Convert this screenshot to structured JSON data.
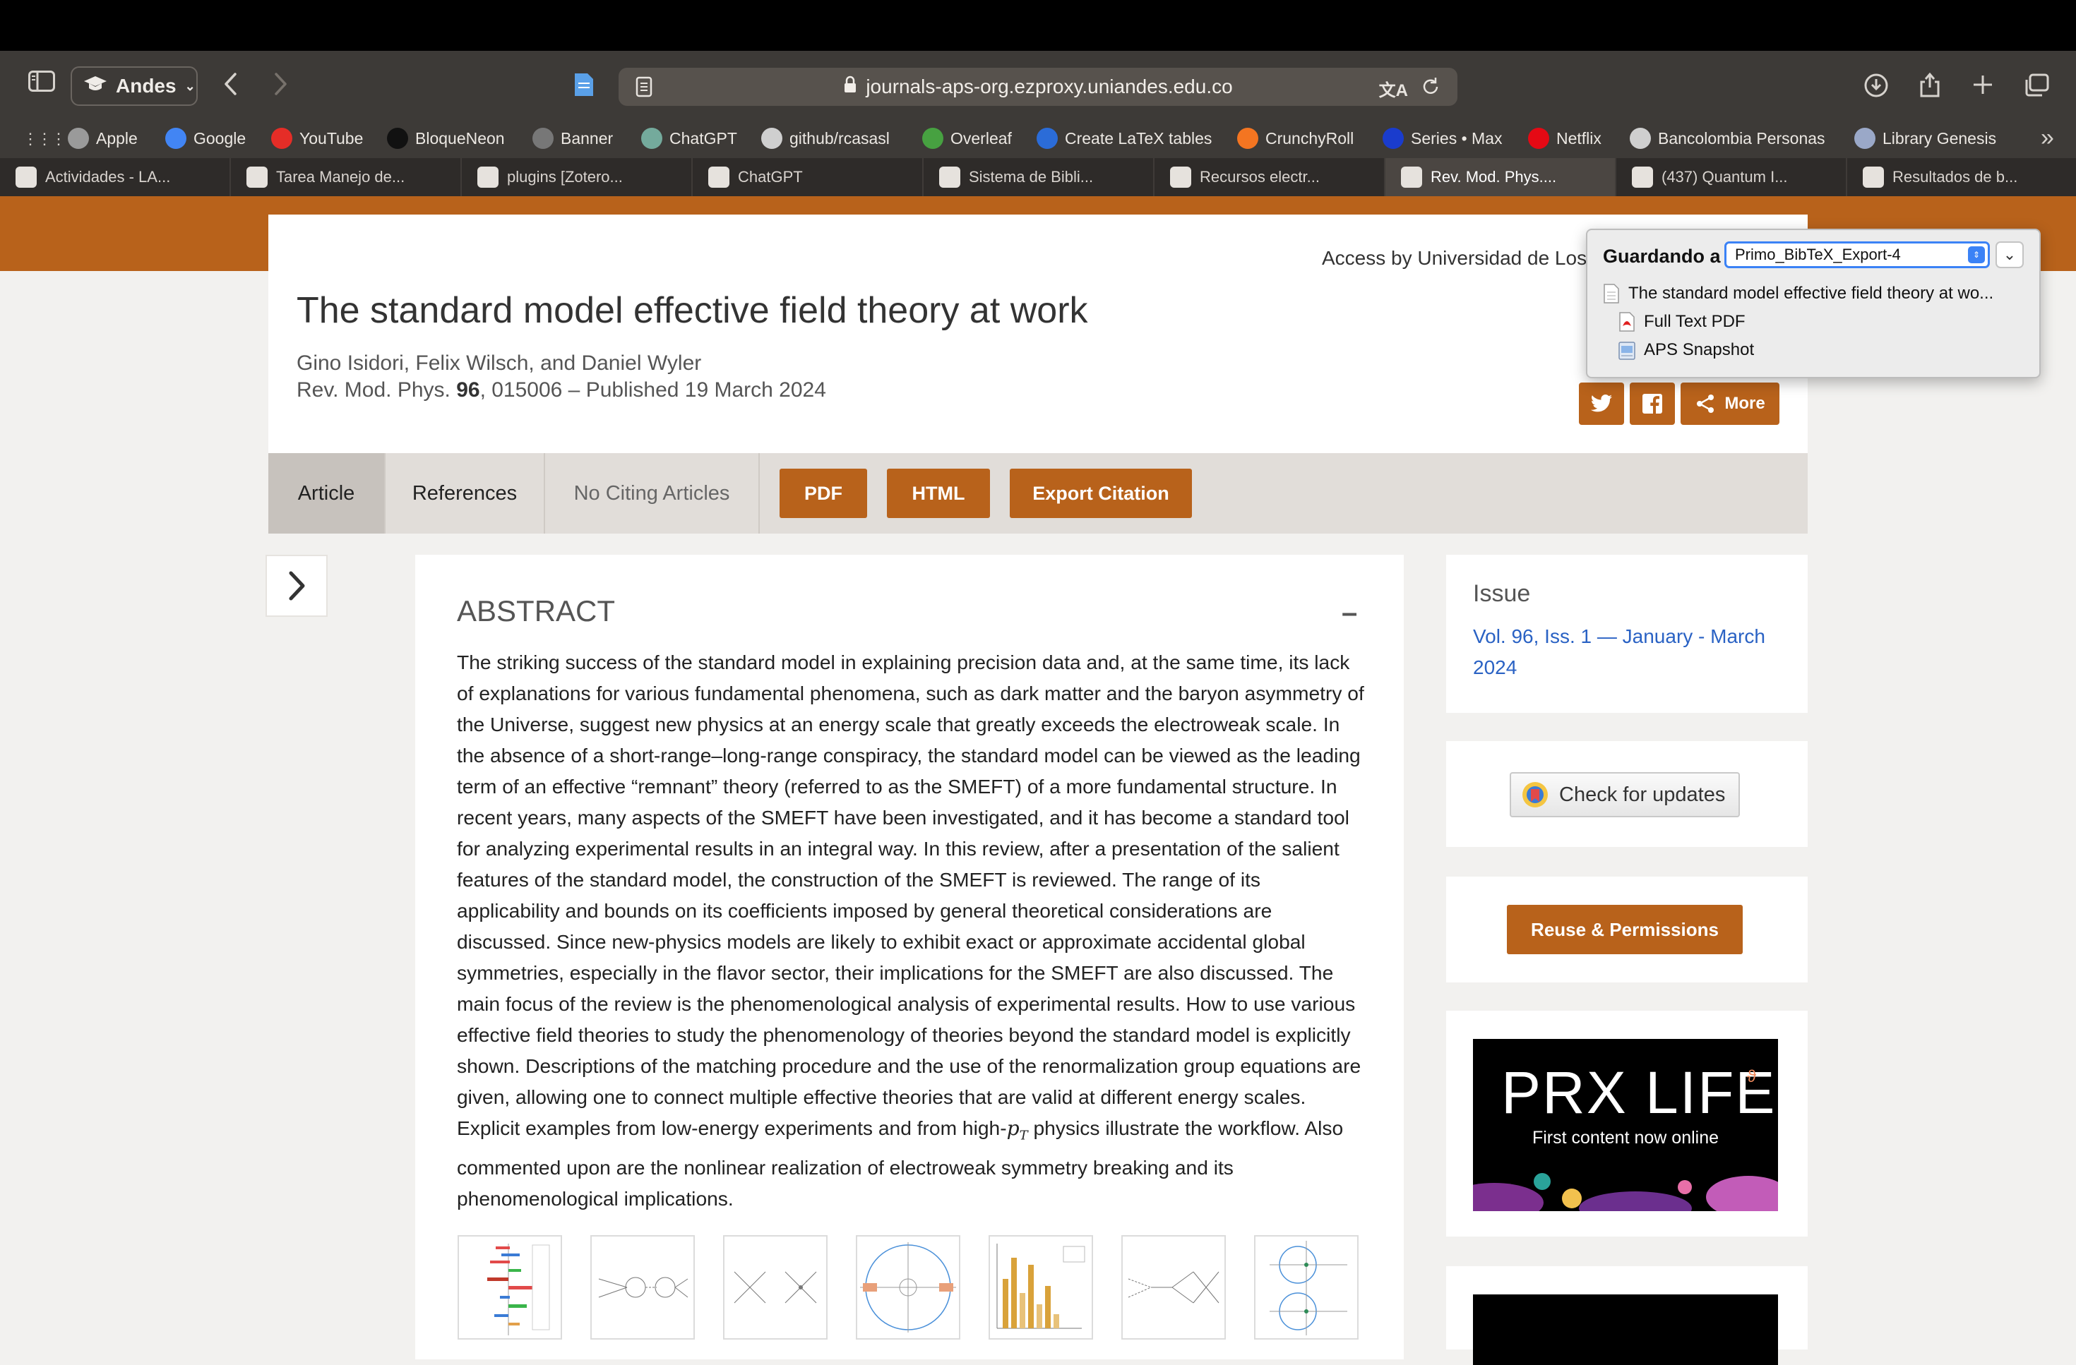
{
  "browser": {
    "profile_name": "Andes",
    "url": "journals-aps-org.ezproxy.uniandes.edu.co",
    "bookmarks": [
      {
        "label": "Apple",
        "icon": "apple-icon",
        "color": "#9a9a9a"
      },
      {
        "label": "Google",
        "icon": "google-icon",
        "color": "#4285f4"
      },
      {
        "label": "YouTube",
        "icon": "youtube-icon",
        "color": "#e52d27"
      },
      {
        "label": "BloqueNeon",
        "icon": "d2l-icon",
        "color": "#111111"
      },
      {
        "label": "Banner",
        "icon": "banner-icon",
        "color": "#777777"
      },
      {
        "label": "ChatGPT",
        "icon": "chatgpt-icon",
        "color": "#74aa9c"
      },
      {
        "label": "github/rcasasl",
        "icon": "github-icon",
        "color": "#cfcfcf"
      },
      {
        "label": "Overleaf",
        "icon": "overleaf-icon",
        "color": "#47a141"
      },
      {
        "label": "Create LaTeX tables",
        "icon": "table-icon",
        "color": "#2b6cd8"
      },
      {
        "label": "CrunchyRoll",
        "icon": "crunchyroll-icon",
        "color": "#f47521"
      },
      {
        "label": "Series • Max",
        "icon": "max-icon",
        "color": "#1a3ccd"
      },
      {
        "label": "Netflix",
        "icon": "netflix-icon",
        "color": "#e50914"
      },
      {
        "label": "Bancolombia Personas",
        "icon": "bancolombia-icon",
        "color": "#cfcfcf"
      },
      {
        "label": "Library Genesis",
        "icon": "library-icon",
        "color": "#9aa8c8"
      }
    ],
    "tabs": [
      {
        "label": "Actividades - LA...",
        "icon": "d2l-icon",
        "active": false
      },
      {
        "label": "Tarea Manejo de...",
        "icon": "overleaf-icon",
        "active": false
      },
      {
        "label": "plugins [Zotero...",
        "icon": "zotero-icon",
        "active": false
      },
      {
        "label": "ChatGPT",
        "icon": "chatgpt-icon",
        "active": false
      },
      {
        "label": "Sistema de Bibli...",
        "icon": "library-icon",
        "active": false
      },
      {
        "label": "Recursos electr...",
        "icon": "library-icon",
        "active": false
      },
      {
        "label": "Rev. Mod. Phys....",
        "icon": "aps-icon",
        "active": true
      },
      {
        "label": "(437) Quantum I...",
        "icon": "youtube-icon",
        "active": false
      },
      {
        "label": "Resultados de b...",
        "icon": "proquest-icon",
        "active": false
      }
    ]
  },
  "page": {
    "access_text": "Access by Universidad de Los",
    "title": "The standard model effective field theory at work",
    "authors": "Gino Isidori, Felix Wilsch, and Daniel Wyler",
    "journal_prefix": "Rev. Mod. Phys. ",
    "volume": "96",
    "citation_rest": ", 015006 – Published 19 March 2024",
    "share_more_label": "More",
    "tabs": [
      "Article",
      "References",
      "No Citing Articles"
    ],
    "buttons": [
      "PDF",
      "HTML",
      "Export Citation"
    ],
    "abstract_heading": "ABSTRACT",
    "abstract_collapse": "–",
    "abstract_part1": "The striking success of the standard model in explaining precision data and, at the same time, its lack of explanations for various fundamental phenomena, such as dark matter and the baryon asymmetry of the Universe, suggest new physics at an energy scale that greatly exceeds the electroweak scale. In the absence of a short-range–long-range conspiracy, the standard model can be viewed as the leading term of an effective “remnant” theory (referred to as the SMEFT) of a more fundamental structure. In recent years, many aspects of the SMEFT have been investigated, and it has become a standard tool for analyzing experimental results in an integral way. In this review, after a presentation of the salient features of the standard model, the construction of the SMEFT is reviewed. The range of its applicability and bounds on its coefficients imposed by general theoretical considerations are discussed. Since new-physics models are likely to exhibit exact or approximate accidental global symmetries, especially in the flavor sector, their implications for the SMEFT are also discussed. The main focus of the review is the phenomenological analysis of experimental results. How to use various effective field theories to study the phenomenology of theories beyond the standard model is explicitly shown. Descriptions of the matching procedure and the use of the renormalization group equations are given, allowing one to connect multiple effective theories that are valid at different energy scales. Explicit examples from low-energy experiments and from high-",
    "abstract_math": "p",
    "abstract_math_sub": "T",
    "abstract_part2": " physics illustrate the workflow. Also commented upon are the nonlinear realization of electroweak symmetry breaking and its phenomenological implications.",
    "issue_label": "Issue",
    "issue_link": "Vol. 96, Iss. 1 — January - March 2024",
    "check_updates": "Check for updates",
    "reuse_permissions": "Reuse & Permissions",
    "ad_title": "PRX LIFE",
    "ad_subtitle": "First content now online"
  },
  "zotero": {
    "label": "Guardando a",
    "collection": "Primo_BibTeX_Export-4",
    "items": [
      {
        "label": "The standard model effective field theory at wo...",
        "icon": "document-icon"
      },
      {
        "label": "Full Text PDF",
        "icon": "pdf-icon"
      },
      {
        "label": "APS Snapshot",
        "icon": "snapshot-icon"
      }
    ]
  },
  "colors": {
    "accent": "#b8621b",
    "link": "#2a62c4",
    "chrome": "#3d3a37"
  }
}
